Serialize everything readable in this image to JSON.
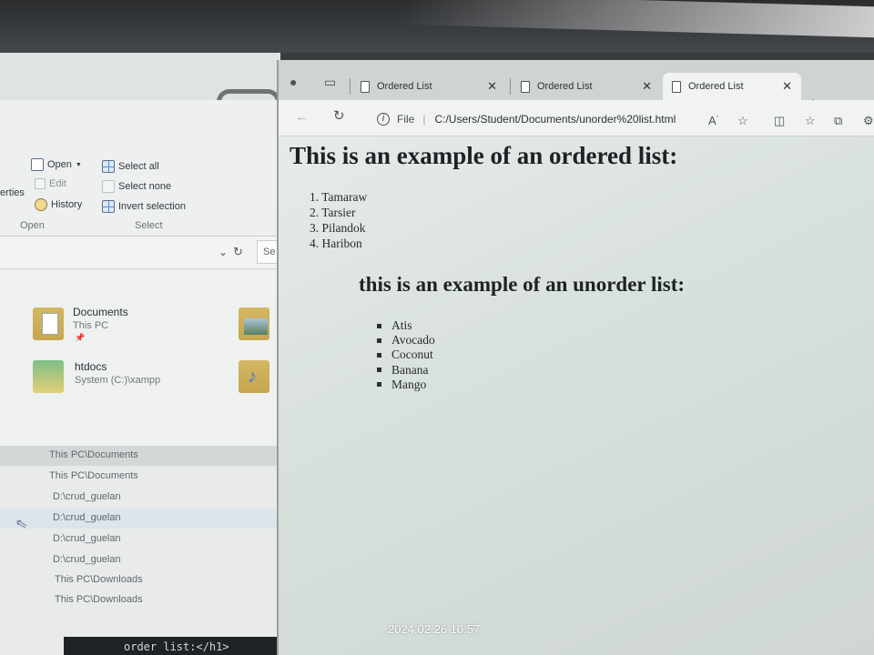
{
  "explorer": {
    "ribbon": {
      "open": "Open",
      "edit": "Edit",
      "history": "History",
      "properties_partial": "erties",
      "group_open": "Open",
      "select_all": "Select all",
      "select_none": "Select none",
      "invert_selection": "Invert selection",
      "group_select": "Select"
    },
    "search_partial": "Se",
    "quick_access": [
      {
        "name": "Documents",
        "location": "This PC"
      },
      {
        "name": "htdocs",
        "location": "System (C:)\\xampp"
      }
    ],
    "recent": [
      "This PC\\Documents",
      "This PC\\Documents",
      "D:\\crud_guelan",
      "D:\\crud_guelan",
      "D:\\crud_guelan",
      "D:\\crud_guelan",
      "This PC\\Downloads",
      "This PC\\Downloads"
    ]
  },
  "editor_snippet": "order list:</h1>",
  "browser": {
    "tabs": [
      "Ordered List",
      "Ordered List",
      "Ordered List"
    ],
    "address": {
      "scheme_label": "File",
      "url": "C:/Users/Student/Documents/unorder%20list.html"
    }
  },
  "page": {
    "heading_ordered": "This is an example of an ordered list:",
    "ordered_items": [
      "1. Tamaraw",
      "2. Tarsier",
      "3. Pilandok",
      "4. Haribon"
    ],
    "heading_unordered": "this is an example of an unorder list:",
    "unordered_items": [
      "Atis",
      "Avocado",
      "Coconut",
      "Banana",
      "Mango"
    ]
  },
  "photo_timestamp": "2024.02.26 10:57"
}
